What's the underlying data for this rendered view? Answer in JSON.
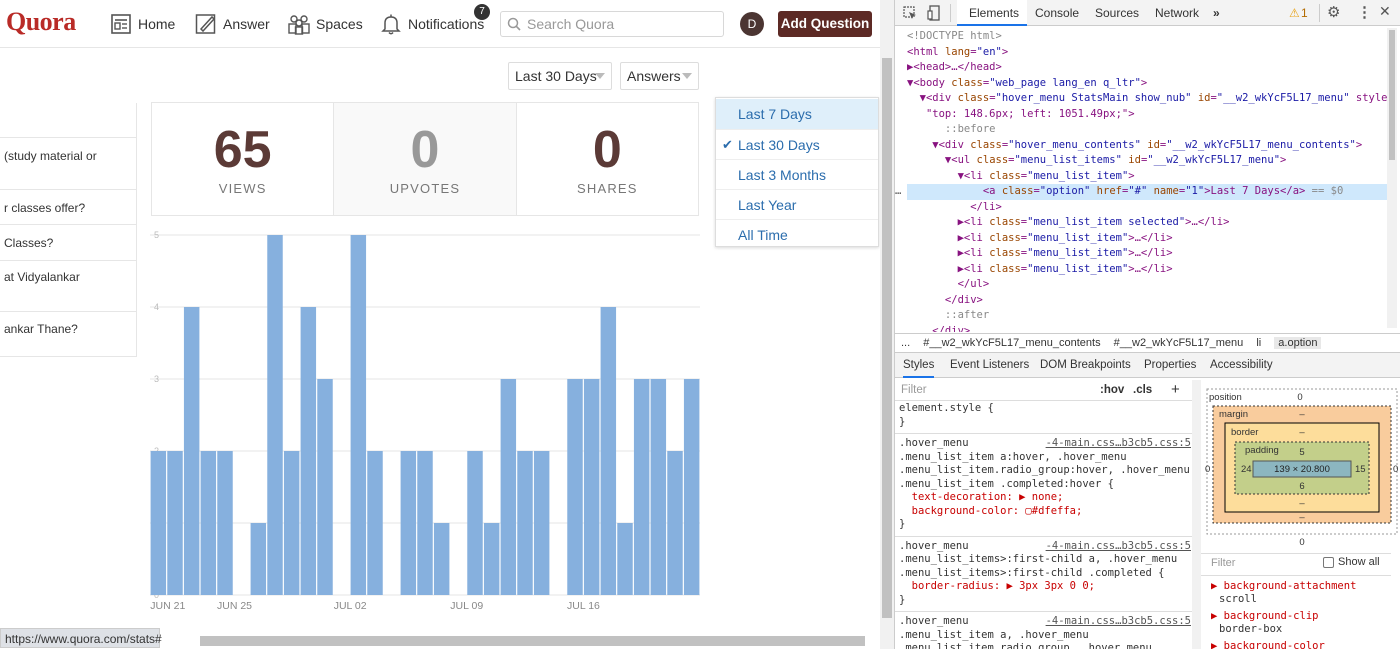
{
  "quora": {
    "logo": "Quora",
    "nav": {
      "home": "Home",
      "answer": "Answer",
      "spaces": "Spaces",
      "notifications": "Notifications",
      "notif_count": "7"
    },
    "search_placeholder": "Search Quora",
    "avatar_initial": "D",
    "add_question": "Add Question",
    "period_select": "Last 30 Days",
    "type_select": "Answers",
    "left_items": [
      "(study material or",
      "r classes offer?",
      "Classes?",
      "at Vidyalankar",
      "ankar Thane?"
    ],
    "stats": [
      {
        "value": "65",
        "label": "VIEWS"
      },
      {
        "value": "0",
        "label": "UPVOTES"
      },
      {
        "value": "0",
        "label": "SHARES"
      }
    ],
    "menu": {
      "items": [
        "Last 7 Days",
        "Last 30 Days",
        "Last 3 Months",
        "Last Year",
        "All Time"
      ],
      "selected": "Last 30 Days",
      "hovered": "Last 7 Days"
    },
    "status_url": "https://www.quora.com/stats#"
  },
  "chart_data": {
    "type": "bar",
    "x_ticks": [
      "JUN 21",
      "JUN 25",
      "JUL 02",
      "JUL 09",
      "JUL 16"
    ],
    "y_ticks": [
      "0",
      "1",
      "2",
      "3",
      "4",
      "5"
    ],
    "ylim": [
      0,
      5
    ],
    "color": "#86b0de",
    "values": [
      2,
      2,
      4,
      2,
      2,
      0,
      1,
      5,
      2,
      4,
      3,
      0,
      5,
      2,
      0,
      2,
      2,
      1,
      0,
      2,
      1,
      3,
      2,
      2,
      0,
      3,
      3,
      4,
      1,
      3,
      3,
      2,
      3
    ]
  },
  "devtools": {
    "tabs": [
      "Elements",
      "Console",
      "Sources",
      "Network"
    ],
    "more": "»",
    "warn_count": "1",
    "dom": [
      "<!DOCTYPE html>",
      "<html lang=\"en\">",
      "▶<head>…</head>",
      "▼<body class=\"web_page lang_en q_ltr\">",
      "  ▼<div class=\"hover_menu StatsMain show_nub\" id=\"__w2_wkYcF5L17_menu\" style=",
      "   \"top: 148.6px; left: 1051.49px;\">",
      "      ::before",
      "    ▼<div class=\"hover_menu_contents\" id=\"__w2_wkYcF5L17_menu_contents\">",
      "      ▼<ul class=\"menu_list_items\" id=\"__w2_wkYcF5L17_menu\">",
      "        ▼<li class=\"menu_list_item\">",
      "            <a class=\"option\" href=\"#\" name=\"1\">Last 7 Days</a> == $0",
      "          </li>",
      "        ▶<li class=\"menu_list_item selected\">…</li>",
      "        ▶<li class=\"menu_list_item\">…</li>",
      "        ▶<li class=\"menu_list_item\">…</li>",
      "        ▶<li class=\"menu_list_item\">…</li>",
      "        </ul>",
      "      </div>",
      "      ::after",
      "    </div>"
    ],
    "crumbs": [
      "...",
      "#__w2_wkYcF5L17_menu_contents",
      "#__w2_wkYcF5L17_menu",
      "li",
      "a.option"
    ],
    "subtabs": [
      "Styles",
      "Event Listeners",
      "DOM Breakpoints",
      "Properties",
      "Accessibility"
    ],
    "filter": "Filter",
    "hov": ":hov",
    "cls": ".cls",
    "plus": "+",
    "rules": [
      {
        "lines": [
          "element.style {",
          "}"
        ],
        "src": ""
      },
      {
        "lines": [
          ".hover_menu",
          ".menu_list_item a:hover, .hover_menu",
          ".menu_list_item.radio_group:hover, .hover_menu",
          ".menu_list_item .completed:hover {",
          "  text-decoration: ▶ none;",
          "  background-color: ▢#dfeffa;",
          "}"
        ],
        "src": "-4-main.css…b3cb5.css:5"
      },
      {
        "lines": [
          ".hover_menu",
          ".menu_list_items>:first-child a, .hover_menu",
          ".menu_list_items>:first-child .completed {",
          "  border-radius: ▶ 3px 3px 0 0;",
          "}"
        ],
        "src": "-4-main.css…b3cb5.css:5"
      },
      {
        "lines": [
          ".hover_menu",
          ".menu_list_item a, .hover_menu",
          ".menu_list_item.radio_group, .hover_menu"
        ],
        "src": "-4-main.css…b3cb5.css:5"
      }
    ],
    "box": {
      "position": "position",
      "position_val": "0",
      "margin": "margin",
      "margin_val": "–",
      "border": "border",
      "border_val": "–",
      "padding": "padding",
      "padding_top": "5",
      "padding_left": "24",
      "padding_right": "15",
      "padding_bottom": "6",
      "content": "139 × 20.800",
      "dash": "–",
      "bottom_zero": "0",
      "left_zero": "0",
      "right_zero": "0"
    },
    "computed_filter": "Filter",
    "show_all": "Show all",
    "computed": [
      [
        "background-attachment",
        "scroll"
      ],
      [
        "background-clip",
        "border-box"
      ],
      [
        "background-color",
        ""
      ]
    ]
  }
}
